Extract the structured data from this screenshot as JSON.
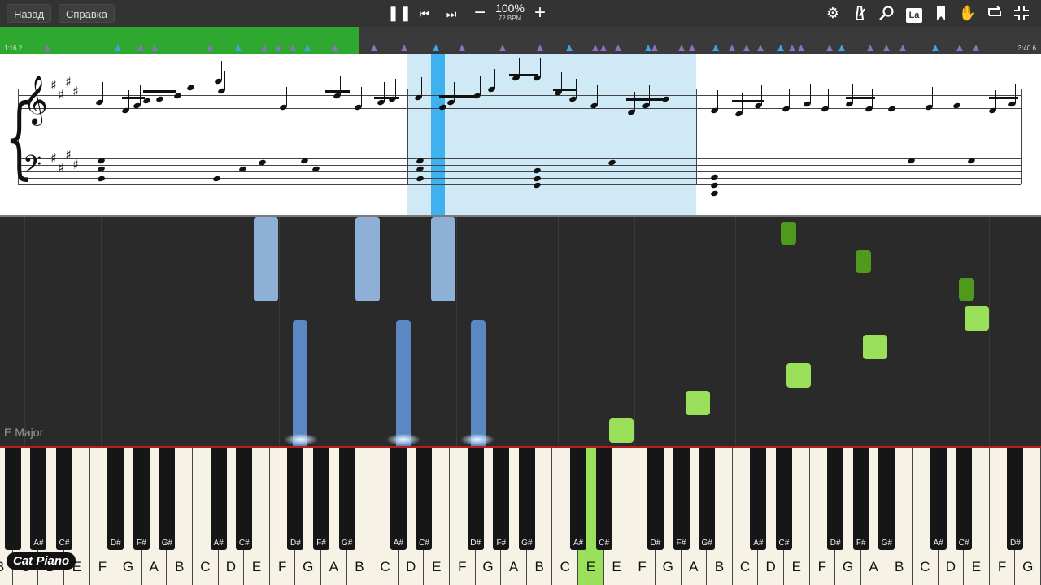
{
  "toolbar": {
    "back_label": "Назад",
    "help_label": "Справка",
    "zoom": "100%",
    "bpm": "72 BPM",
    "pause_icon": "pause-icon",
    "prev_icon": "skip-back-icon",
    "next_icon": "skip-forward-icon",
    "right_icons": [
      "gear-icon",
      "metronome-icon",
      "search-icon",
      "note-label-icon",
      "bookmark-icon",
      "hand-icon",
      "loop-icon",
      "fullscreen-exit-icon"
    ],
    "note_label_text": "La"
  },
  "timeline": {
    "start_time": "1:16.2",
    "end_time": "3:40.6",
    "progress": 0.345
  },
  "key_signature_label": "E Major",
  "watermark": "Cat Piano",
  "colors": {
    "progress": "#2fa82f",
    "left_hand_notes": "#5b88c2",
    "left_hand_light": "#8fb0d6",
    "right_hand_notes": "#9be05a",
    "right_hand_dark": "#4e9a1c",
    "selection": "#cfe9f7",
    "cursor": "#3fb1ee",
    "red_line": "#b81d1d"
  },
  "keyboard": {
    "white_keys": [
      "B",
      "C",
      "D",
      "E",
      "F",
      "G",
      "A",
      "B",
      "C",
      "D",
      "E",
      "F",
      "G",
      "A",
      "B",
      "C",
      "D",
      "E",
      "F",
      "G",
      "A",
      "B",
      "C",
      "D",
      "E",
      "F",
      "G",
      "A",
      "B",
      "C",
      "D",
      "E",
      "F",
      "G",
      "A",
      "B",
      "C",
      "D",
      "E",
      "F",
      "G"
    ],
    "active_key": "E",
    "black_key_labels": [
      "A#",
      "C#",
      "D#",
      "F#",
      "G#",
      "A#",
      "C#",
      "D#",
      "F#",
      "G#",
      "A#",
      "C#",
      "D#",
      "F#",
      "G#",
      "A#",
      "C#",
      "D#",
      "F#",
      "G#",
      "A#",
      "C#",
      "D#",
      "F#",
      "G#",
      "A#",
      "C#",
      "D#",
      "F#",
      "G#"
    ]
  }
}
